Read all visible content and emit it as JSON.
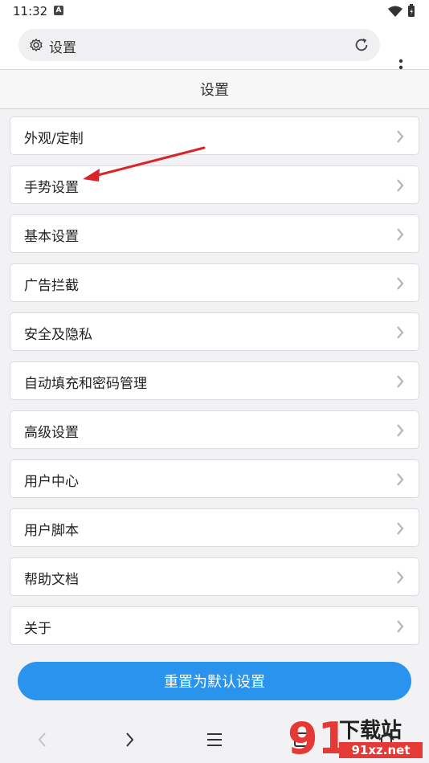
{
  "status": {
    "time": "11:32",
    "notif_icon": "a-icon"
  },
  "urlbar": {
    "text": "设置"
  },
  "header": {
    "title": "设置"
  },
  "items": [
    {
      "label": "外观/定制"
    },
    {
      "label": "手势设置"
    },
    {
      "label": "基本设置"
    },
    {
      "label": "广告拦截"
    },
    {
      "label": "安全及隐私"
    },
    {
      "label": "自动填充和密码管理"
    },
    {
      "label": "高级设置"
    },
    {
      "label": "用户中心"
    },
    {
      "label": "用户脚本"
    },
    {
      "label": "帮助文档"
    },
    {
      "label": "关于"
    }
  ],
  "reset_button": {
    "label": "重置为默认设置"
  },
  "watermark": {
    "text_main": "下载站",
    "text_sub": "91xz.net",
    "num": "91"
  },
  "colors": {
    "accent": "#2a93ee",
    "arrow": "#d9252a"
  }
}
